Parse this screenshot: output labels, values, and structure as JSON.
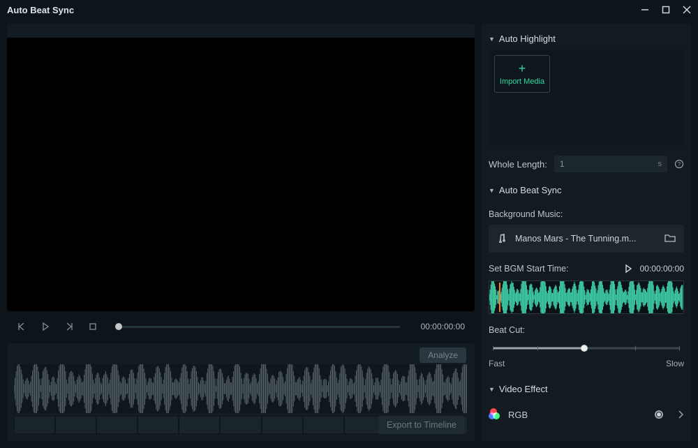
{
  "window": {
    "title": "Auto Beat Sync"
  },
  "preview": {
    "timecode": "00:00:00:00",
    "analyze_label": "Analyze",
    "export_label": "Export to Timeline"
  },
  "right": {
    "auto_highlight": {
      "title": "Auto Highlight",
      "import_label": "Import Media",
      "whole_length_label": "Whole Length:",
      "whole_length_value": "1",
      "whole_length_unit": "s"
    },
    "auto_beat_sync": {
      "title": "Auto Beat Sync",
      "bg_music_label": "Background Music:",
      "music_name": "Manos Mars - The Tunning.m...",
      "bgm_start_label": "Set BGM Start Time:",
      "bgm_start_value": "00:00:00:00",
      "beat_cut_label": "Beat Cut:",
      "beat_fast": "Fast",
      "beat_slow": "Slow"
    },
    "video_effect": {
      "title": "Video Effect",
      "item_label": "RGB"
    }
  }
}
